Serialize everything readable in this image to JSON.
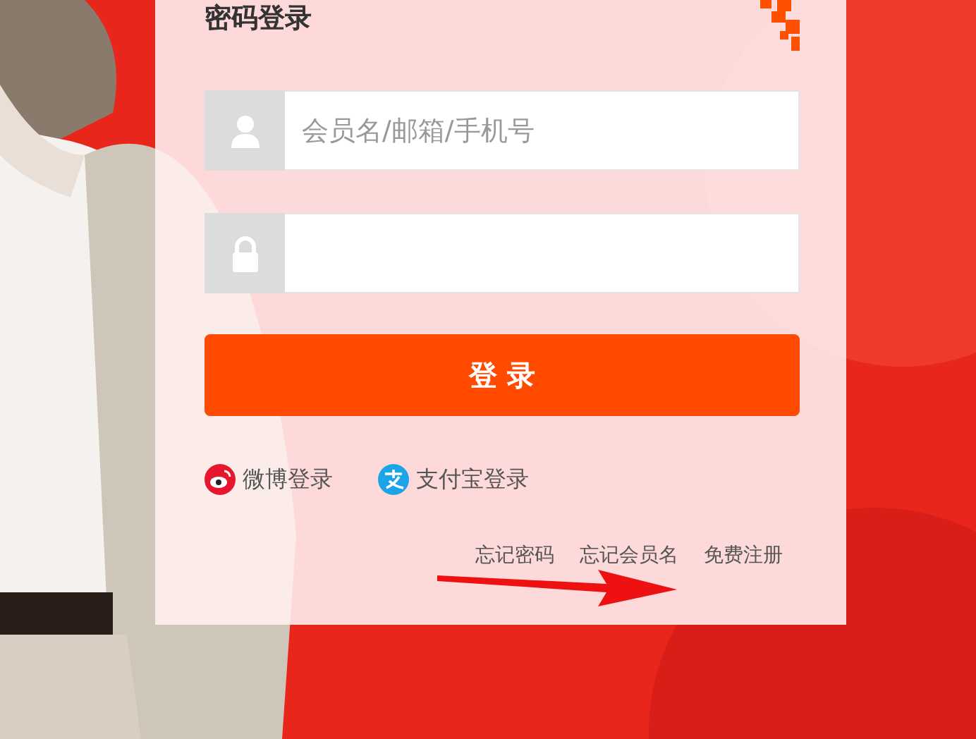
{
  "login": {
    "title": "密码登录",
    "username": {
      "placeholder": "会员名/邮箱/手机号"
    },
    "submit": "登 录",
    "social": [
      {
        "kind": "weibo",
        "label": "微博登录"
      },
      {
        "kind": "alipay",
        "label": "支付宝登录"
      }
    ],
    "links": [
      "忘记密码",
      "忘记会员名",
      "免费注册"
    ]
  },
  "annotation": {
    "kind": "arrow"
  }
}
